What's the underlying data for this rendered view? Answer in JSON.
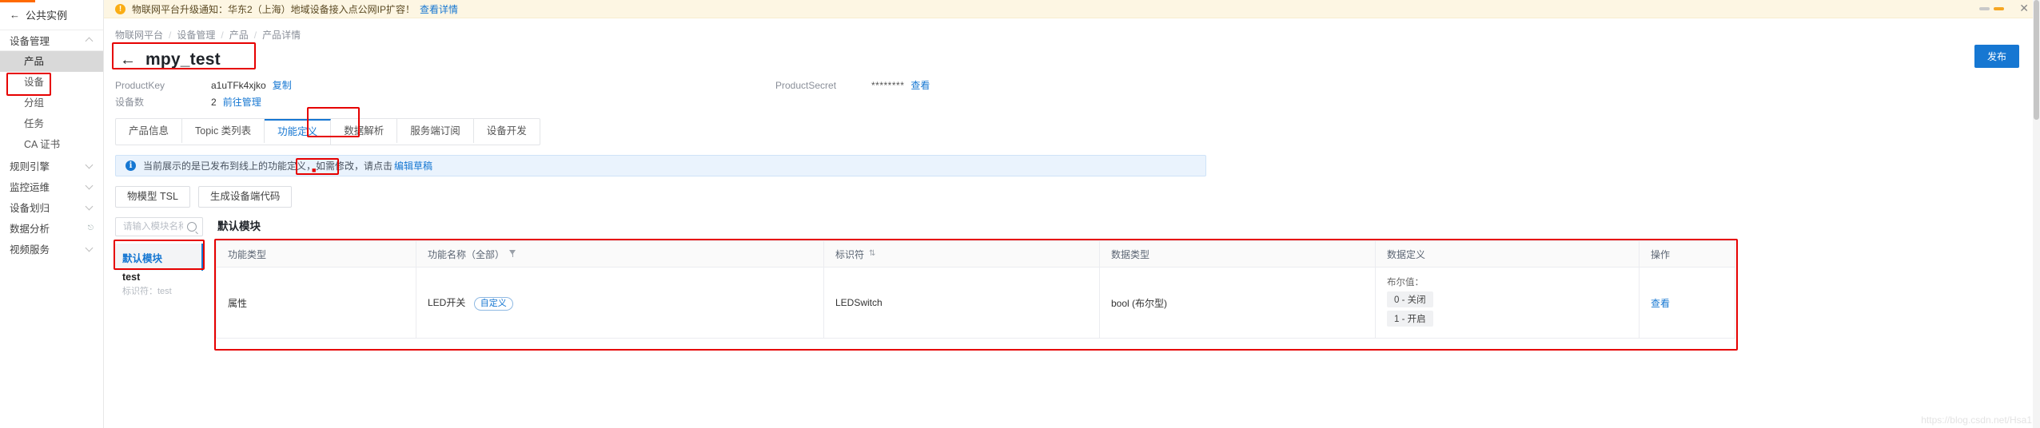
{
  "sidebar": {
    "instance": {
      "label": "公共实例",
      "back_icon": "arrow-left-icon"
    },
    "groups": [
      {
        "label": "设备管理",
        "expanded": true,
        "chevron": "chevron-up-icon",
        "items": [
          {
            "label": "产品",
            "selected": true,
            "highlighted": true
          },
          {
            "label": "设备",
            "selected": false
          },
          {
            "label": "分组",
            "selected": false
          },
          {
            "label": "任务",
            "selected": false
          },
          {
            "label": "CA 证书",
            "selected": false
          }
        ]
      },
      {
        "label": "规则引擎",
        "expanded": false,
        "chevron": "chevron-down-icon",
        "items": []
      },
      {
        "label": "监控运维",
        "expanded": false,
        "chevron": "chevron-down-icon",
        "items": []
      },
      {
        "label": "设备划归",
        "expanded": false,
        "chevron": "chevron-down-icon",
        "items": []
      },
      {
        "label": "数据分析",
        "expanded": false,
        "chevron": "external-link-icon",
        "external": true,
        "items": []
      },
      {
        "label": "视频服务",
        "expanded": false,
        "chevron": "chevron-down-icon",
        "items": []
      }
    ]
  },
  "notice": {
    "icon": "warning-circle-icon",
    "text": "物联网平台升级通知：华东2（上海）地域设备接入点公网IP扩容！",
    "link": "查看详情",
    "close_icon": "close-icon",
    "dots": [
      "inactive",
      "active"
    ]
  },
  "breadcrumb": [
    "物联网平台",
    "设备管理",
    "产品",
    "产品详情"
  ],
  "header": {
    "back_icon": "arrow-left-icon",
    "title": "mpy_test",
    "publish_button": "发布"
  },
  "meta": {
    "product_key_label": "ProductKey",
    "product_key_value": "a1uTFk4xjko",
    "product_key_action": "复制",
    "device_count_label": "设备数",
    "device_count_value": "2",
    "device_count_action": "前往管理",
    "product_secret_label": "ProductSecret",
    "product_secret_value": "********",
    "product_secret_action": "查看"
  },
  "tabs": [
    {
      "label": "产品信息",
      "active": false
    },
    {
      "label": "Topic 类列表",
      "active": false
    },
    {
      "label": "功能定义",
      "active": true,
      "highlighted": true
    },
    {
      "label": "数据解析",
      "active": false
    },
    {
      "label": "服务端订阅",
      "active": false
    },
    {
      "label": "设备开发",
      "active": false
    }
  ],
  "alert": {
    "icon": "info-circle-icon",
    "text": "当前展示的是已发布到线上的功能定义，如需修改，请点击",
    "link": "编辑草稿"
  },
  "actions": [
    {
      "label": "物模型 TSL"
    },
    {
      "label": "生成设备端代码"
    }
  ],
  "modules": {
    "search_placeholder": "请输入模块名称",
    "search_value": "",
    "search_icon": "search-icon",
    "items": [
      {
        "name": "默认模块",
        "sub": "",
        "selected": true,
        "highlighted": true
      },
      {
        "name": "test",
        "sub": "标识符：test",
        "selected": false
      }
    ]
  },
  "table": {
    "title": "默认模块",
    "columns": [
      {
        "label": "功能类型",
        "icon": ""
      },
      {
        "label": "功能名称（全部）",
        "icon": "filter-icon"
      },
      {
        "label": "标识符",
        "icon": "sort-icon"
      },
      {
        "label": "数据类型",
        "icon": ""
      },
      {
        "label": "数据定义",
        "icon": ""
      },
      {
        "label": "操作",
        "icon": ""
      }
    ],
    "rows": [
      {
        "type": "属性",
        "name": "LED开关",
        "name_tag": "自定义",
        "identifier": "LEDSwitch",
        "data_type": "bool (布尔型)",
        "definition_label": "布尔值：",
        "definition_values": [
          "0 - 关闭",
          "1 - 开启"
        ],
        "operation": "查看"
      }
    ]
  },
  "watermark": "https://blog.csdn.net/Hsa1",
  "colors": {
    "accent": "#1677d2",
    "highlight_box": "#e60000",
    "warning": "#faad14",
    "notice_bg": "#fdf6e3",
    "alert_bg": "#eaf3fd"
  }
}
